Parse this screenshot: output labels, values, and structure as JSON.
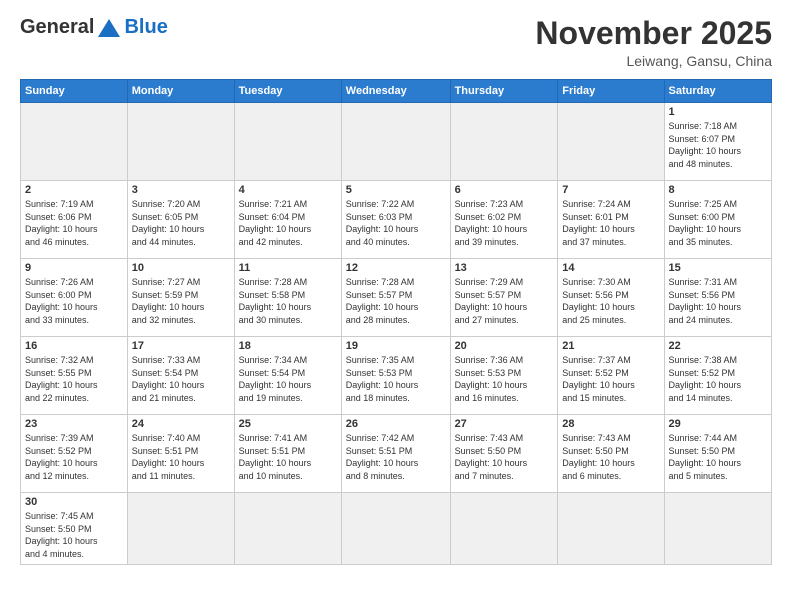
{
  "header": {
    "logo_general": "General",
    "logo_blue": "Blue",
    "month_title": "November 2025",
    "location": "Leiwang, Gansu, China"
  },
  "weekdays": [
    "Sunday",
    "Monday",
    "Tuesday",
    "Wednesday",
    "Thursday",
    "Friday",
    "Saturday"
  ],
  "days": [
    {
      "number": "",
      "info": ""
    },
    {
      "number": "",
      "info": ""
    },
    {
      "number": "",
      "info": ""
    },
    {
      "number": "",
      "info": ""
    },
    {
      "number": "",
      "info": ""
    },
    {
      "number": "",
      "info": ""
    },
    {
      "number": "1",
      "info": "Sunrise: 7:18 AM\nSunset: 6:07 PM\nDaylight: 10 hours\nand 48 minutes."
    },
    {
      "number": "2",
      "info": "Sunrise: 7:19 AM\nSunset: 6:06 PM\nDaylight: 10 hours\nand 46 minutes."
    },
    {
      "number": "3",
      "info": "Sunrise: 7:20 AM\nSunset: 6:05 PM\nDaylight: 10 hours\nand 44 minutes."
    },
    {
      "number": "4",
      "info": "Sunrise: 7:21 AM\nSunset: 6:04 PM\nDaylight: 10 hours\nand 42 minutes."
    },
    {
      "number": "5",
      "info": "Sunrise: 7:22 AM\nSunset: 6:03 PM\nDaylight: 10 hours\nand 40 minutes."
    },
    {
      "number": "6",
      "info": "Sunrise: 7:23 AM\nSunset: 6:02 PM\nDaylight: 10 hours\nand 39 minutes."
    },
    {
      "number": "7",
      "info": "Sunrise: 7:24 AM\nSunset: 6:01 PM\nDaylight: 10 hours\nand 37 minutes."
    },
    {
      "number": "8",
      "info": "Sunrise: 7:25 AM\nSunset: 6:00 PM\nDaylight: 10 hours\nand 35 minutes."
    },
    {
      "number": "9",
      "info": "Sunrise: 7:26 AM\nSunset: 6:00 PM\nDaylight: 10 hours\nand 33 minutes."
    },
    {
      "number": "10",
      "info": "Sunrise: 7:27 AM\nSunset: 5:59 PM\nDaylight: 10 hours\nand 32 minutes."
    },
    {
      "number": "11",
      "info": "Sunrise: 7:28 AM\nSunset: 5:58 PM\nDaylight: 10 hours\nand 30 minutes."
    },
    {
      "number": "12",
      "info": "Sunrise: 7:28 AM\nSunset: 5:57 PM\nDaylight: 10 hours\nand 28 minutes."
    },
    {
      "number": "13",
      "info": "Sunrise: 7:29 AM\nSunset: 5:57 PM\nDaylight: 10 hours\nand 27 minutes."
    },
    {
      "number": "14",
      "info": "Sunrise: 7:30 AM\nSunset: 5:56 PM\nDaylight: 10 hours\nand 25 minutes."
    },
    {
      "number": "15",
      "info": "Sunrise: 7:31 AM\nSunset: 5:56 PM\nDaylight: 10 hours\nand 24 minutes."
    },
    {
      "number": "16",
      "info": "Sunrise: 7:32 AM\nSunset: 5:55 PM\nDaylight: 10 hours\nand 22 minutes."
    },
    {
      "number": "17",
      "info": "Sunrise: 7:33 AM\nSunset: 5:54 PM\nDaylight: 10 hours\nand 21 minutes."
    },
    {
      "number": "18",
      "info": "Sunrise: 7:34 AM\nSunset: 5:54 PM\nDaylight: 10 hours\nand 19 minutes."
    },
    {
      "number": "19",
      "info": "Sunrise: 7:35 AM\nSunset: 5:53 PM\nDaylight: 10 hours\nand 18 minutes."
    },
    {
      "number": "20",
      "info": "Sunrise: 7:36 AM\nSunset: 5:53 PM\nDaylight: 10 hours\nand 16 minutes."
    },
    {
      "number": "21",
      "info": "Sunrise: 7:37 AM\nSunset: 5:52 PM\nDaylight: 10 hours\nand 15 minutes."
    },
    {
      "number": "22",
      "info": "Sunrise: 7:38 AM\nSunset: 5:52 PM\nDaylight: 10 hours\nand 14 minutes."
    },
    {
      "number": "23",
      "info": "Sunrise: 7:39 AM\nSunset: 5:52 PM\nDaylight: 10 hours\nand 12 minutes."
    },
    {
      "number": "24",
      "info": "Sunrise: 7:40 AM\nSunset: 5:51 PM\nDaylight: 10 hours\nand 11 minutes."
    },
    {
      "number": "25",
      "info": "Sunrise: 7:41 AM\nSunset: 5:51 PM\nDaylight: 10 hours\nand 10 minutes."
    },
    {
      "number": "26",
      "info": "Sunrise: 7:42 AM\nSunset: 5:51 PM\nDaylight: 10 hours\nand 8 minutes."
    },
    {
      "number": "27",
      "info": "Sunrise: 7:43 AM\nSunset: 5:50 PM\nDaylight: 10 hours\nand 7 minutes."
    },
    {
      "number": "28",
      "info": "Sunrise: 7:43 AM\nSunset: 5:50 PM\nDaylight: 10 hours\nand 6 minutes."
    },
    {
      "number": "29",
      "info": "Sunrise: 7:44 AM\nSunset: 5:50 PM\nDaylight: 10 hours\nand 5 minutes."
    },
    {
      "number": "30",
      "info": "Sunrise: 7:45 AM\nSunset: 5:50 PM\nDaylight: 10 hours\nand 4 minutes."
    },
    {
      "number": "",
      "info": ""
    },
    {
      "number": "",
      "info": ""
    },
    {
      "number": "",
      "info": ""
    },
    {
      "number": "",
      "info": ""
    },
    {
      "number": "",
      "info": ""
    },
    {
      "number": "",
      "info": ""
    }
  ]
}
